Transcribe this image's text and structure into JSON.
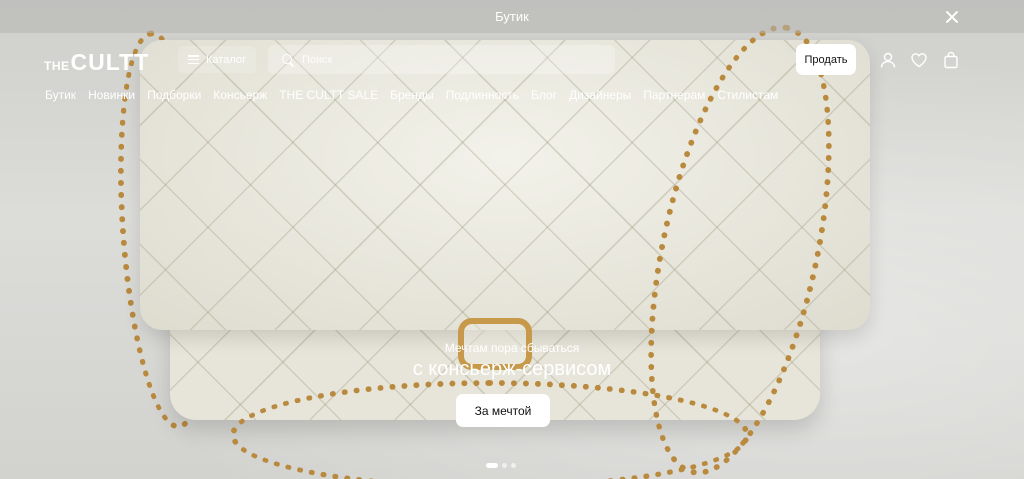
{
  "announcement": {
    "text": "Бутик"
  },
  "header": {
    "logo_prefix": "THE",
    "logo_main": "CULTT",
    "catalog_label": "Каталог",
    "search_placeholder": "Поиск",
    "sell_label": "Продать",
    "icons": [
      "user-icon",
      "heart-icon",
      "shopping-bag-icon"
    ]
  },
  "nav": {
    "items": [
      {
        "label": "Бутик"
      },
      {
        "label": "Новинки"
      },
      {
        "label": "Подборки"
      },
      {
        "label": "Консьерж"
      },
      {
        "label": "THE CULTT SALE"
      },
      {
        "label": "Бренды"
      },
      {
        "label": "Подлинность"
      },
      {
        "label": "Блог"
      },
      {
        "label": "Дизайнеры"
      },
      {
        "label": "Партнерам"
      },
      {
        "label": "Стилистам"
      }
    ]
  },
  "hero": {
    "subtitle": "Мечтам пора сбываться",
    "title": "с консьерж-сервисом",
    "cta_label": "За мечтой",
    "slides_total": 3,
    "active_slide": 1
  }
}
